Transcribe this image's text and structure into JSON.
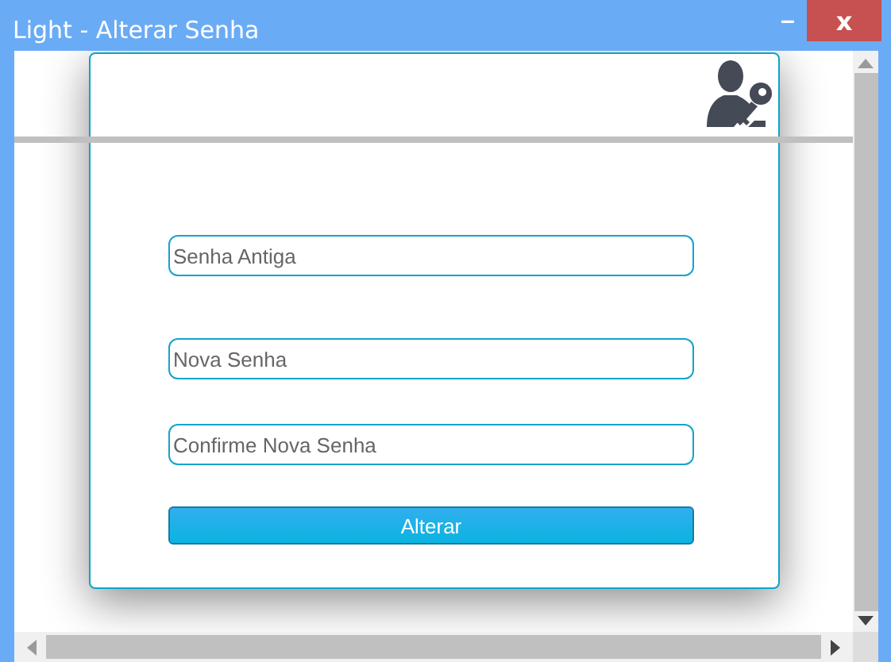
{
  "window": {
    "title": "Light - Alterar Senha",
    "minimize": "–",
    "close": "x"
  },
  "dialog": {
    "fields": [
      {
        "placeholder": "Senha Antiga"
      },
      {
        "placeholder": "Nova Senha"
      },
      {
        "placeholder": "Confirme Nova Senha"
      }
    ],
    "button": "Alterar"
  }
}
